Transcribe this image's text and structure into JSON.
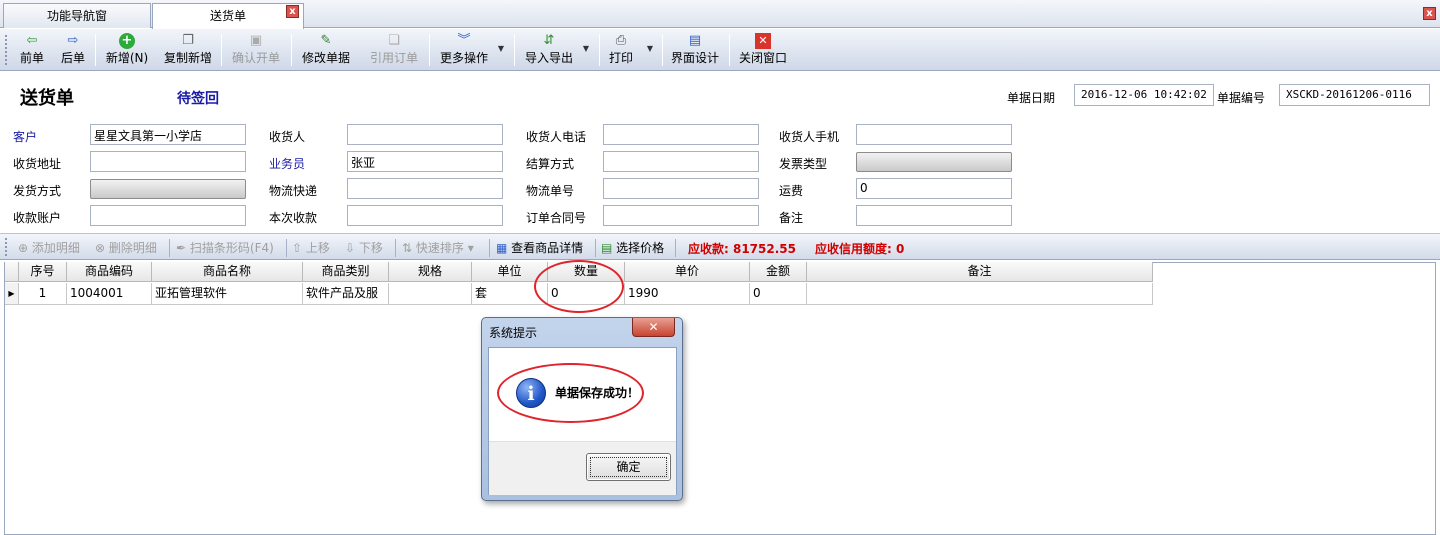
{
  "tabs": [
    {
      "label": "功能导航窗"
    },
    {
      "label": "送货单"
    }
  ],
  "toolbar": {
    "prev": "前单",
    "next": "后单",
    "add": "新增(N)",
    "copy_add": "复制新增",
    "confirm": "确认开单",
    "edit": "修改单据",
    "ref_order": "引用订单",
    "more": "更多操作",
    "import_export": "导入导出",
    "print": "打印",
    "design": "界面设计",
    "close": "关闭窗口"
  },
  "header": {
    "title": "送货单",
    "status": "待签回",
    "date_label": "单据日期",
    "date_value": "2016-12-06 10:42:02",
    "no_label": "单据编号",
    "no_value": "XSCKD-20161206-0116"
  },
  "form": {
    "customer_label": "客户",
    "customer_value": "星星文具第一小学店",
    "consignee_label": "收货人",
    "consignee_phone_label": "收货人电话",
    "consignee_mobile_label": "收货人手机",
    "address_label": "收货地址",
    "salesman_label": "业务员",
    "salesman_value": "张亚",
    "settle_label": "结算方式",
    "invoice_label": "发票类型",
    "ship_label": "发货方式",
    "logistics_label": "物流快递",
    "tracking_label": "物流单号",
    "freight_label": "运费",
    "freight_value": "0",
    "account_label": "收款账户",
    "this_receipt_label": "本次收款",
    "contract_label": "订单合同号",
    "remark_label": "备注"
  },
  "detail_toolbar": {
    "add_detail": "添加明细",
    "del_detail": "删除明细",
    "scan": "扫描条形码(F4)",
    "up": "上移",
    "down": "下移",
    "sort": "快速排序",
    "view_detail": "查看商品详情",
    "select_price": "选择价格",
    "receivable": "应收款: 81752.55",
    "credit": "应收信用额度: 0"
  },
  "grid": {
    "columns": [
      "序号",
      "商品编码",
      "商品名称",
      "商品类别",
      "规格",
      "单位",
      "数量",
      "单价",
      "金额",
      "备注"
    ],
    "rows": [
      [
        "1",
        "1004001",
        "亚拓管理软件",
        "软件产品及服",
        "",
        "套",
        "0",
        "1990",
        "0",
        ""
      ]
    ]
  },
  "dialog": {
    "title": "系统提示",
    "message": "单据保存成功！",
    "ok": "确定",
    "close_glyph": "✕"
  },
  "colors": {
    "accent_blue": "#1a1aa6",
    "alert_red": "#d00000",
    "annotation_red": "#e0242b"
  }
}
